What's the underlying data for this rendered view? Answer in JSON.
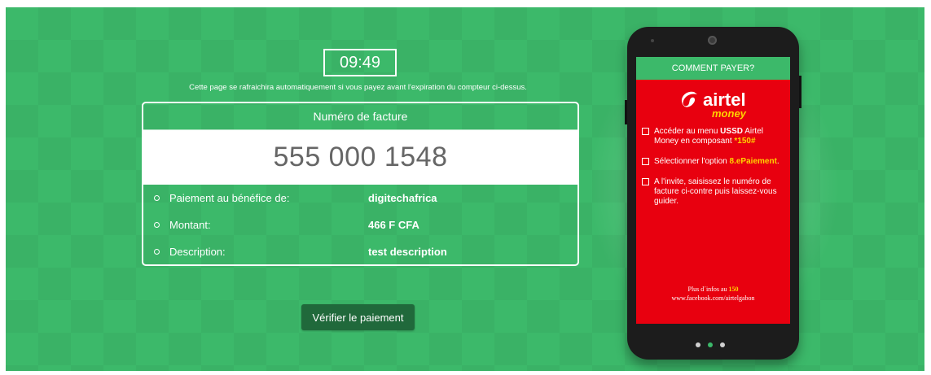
{
  "timer": {
    "value": "09:49"
  },
  "refresh_note": "Cette page se rafraichira automatiquement si vous payez avant l'expiration du compteur ci-dessus.",
  "invoice": {
    "header": "Numéro de facture",
    "number": "555 000 1548",
    "details": [
      {
        "label": "Paiement au bénéfice de:",
        "value": "digitechafrica"
      },
      {
        "label": "Montant:",
        "value": "466 F CFA"
      },
      {
        "label": "Description:",
        "value": "test description"
      }
    ]
  },
  "verify_button": {
    "label": "Vérifier le paiement"
  },
  "phone": {
    "header": "COMMENT PAYER?",
    "logo": {
      "brand": "airtel",
      "sub": "money"
    },
    "steps": {
      "s1_a": "Accéder au menu ",
      "s1_b": "USSD",
      "s1_c": " Airtel Money en composant ",
      "s1_d": "*150#",
      "s2_a": "Sélectionner l'option ",
      "s2_b": "8.ePaiement",
      "s2_c": ".",
      "s3": "A l'invite, saisissez le numéro de facture ci-contre puis laissez-vous guider."
    },
    "footer": {
      "line1_a": "Plus d´infos au ",
      "line1_b": "150",
      "line2": "www.facebook.com/airtelgabon"
    }
  },
  "colors": {
    "background": "#3cb96a",
    "button": "#20693b",
    "airtel_red": "#e8000f",
    "highlight_yellow": "#ffd200"
  }
}
